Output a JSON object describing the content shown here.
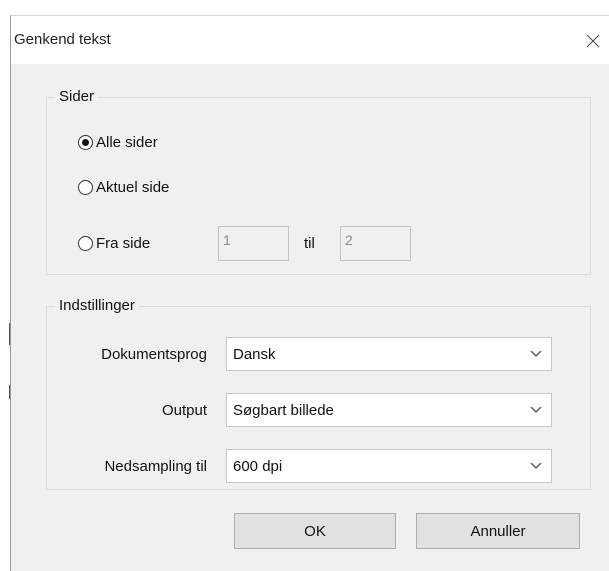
{
  "dialog": {
    "title": "Genkend tekst",
    "close_icon": "close-icon"
  },
  "pages_group": {
    "legend": "Sider",
    "options": [
      {
        "label": "Alle sider",
        "selected": true
      },
      {
        "label": "Aktuel side",
        "selected": false
      },
      {
        "label": "Fra side",
        "selected": false
      }
    ],
    "from_value": "1",
    "to_label": "til",
    "to_value": "2"
  },
  "settings_group": {
    "legend": "Indstillinger",
    "fields": [
      {
        "label": "Dokumentsprog",
        "value": "Dansk"
      },
      {
        "label": "Output",
        "value": "Søgbart billede"
      },
      {
        "label": "Nedsampling til",
        "value": "600 dpi"
      }
    ],
    "dropdown_icon": "chevron-down-icon"
  },
  "buttons": {
    "ok": "OK",
    "cancel": "Annuller"
  }
}
